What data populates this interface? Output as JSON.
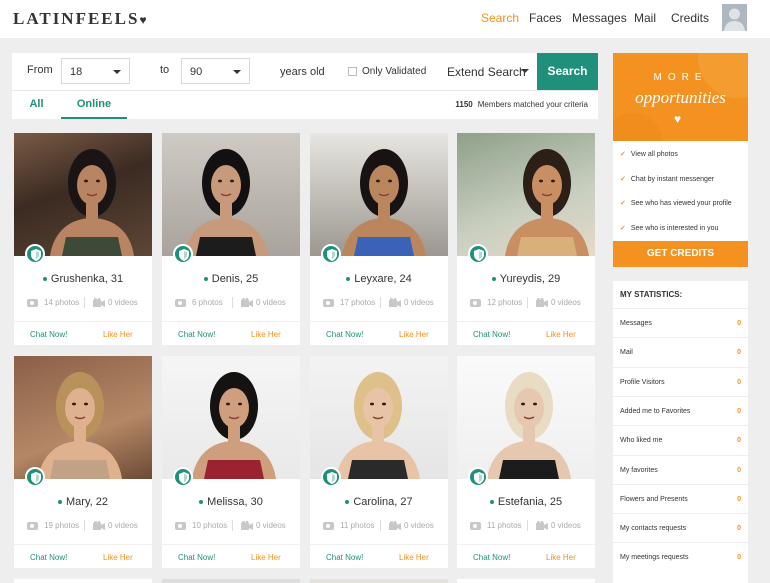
{
  "header": {
    "logo": "LATINFEELS",
    "logo_heart": "♥",
    "nav": [
      "Search",
      "Faces",
      "Messages",
      "Mail",
      "Credits"
    ],
    "active_nav": "Search"
  },
  "search": {
    "from_label": "From",
    "from_value": "18",
    "to_label": "to",
    "to_value": "90",
    "years_label": "years old",
    "only_validated": "Only Validated",
    "extend_search": "Extend Search",
    "search_button": "Search"
  },
  "tabs": [
    "All",
    "Online"
  ],
  "active_tab": "Online",
  "matched": {
    "count": "1150",
    "text": "Members matched your criteria"
  },
  "cards": [
    {
      "name": "Grushenka, 31",
      "photos": "14 photos",
      "videos": "0 videos",
      "chat": "Chat Now!",
      "like": "Like Her"
    },
    {
      "name": "Denis, 25",
      "photos": "6 photos",
      "videos": "0 videos",
      "chat": "Chat Now!",
      "like": "Like Her"
    },
    {
      "name": "Leyxare, 24",
      "photos": "17 photos",
      "videos": "0 videos",
      "chat": "Chat Now!",
      "like": "Like Her"
    },
    {
      "name": "Yureydis, 29",
      "photos": "12 photos",
      "videos": "0 videos",
      "chat": "Chat Now!",
      "like": "Like Her"
    },
    {
      "name": "Mary, 22",
      "photos": "19 photos",
      "videos": "0 videos",
      "chat": "Chat Now!",
      "like": "Like Her"
    },
    {
      "name": "Melissa, 30",
      "photos": "10 photos",
      "videos": "0 videos",
      "chat": "Chat Now!",
      "like": "Like Her"
    },
    {
      "name": "Carolina, 27",
      "photos": "11 photos",
      "videos": "0 videos",
      "chat": "Chat Now!",
      "like": "Like Her"
    },
    {
      "name": "Estefania, 25",
      "photos": "11 photos",
      "videos": "0 videos",
      "chat": "Chat Now!",
      "like": "Like Her"
    }
  ],
  "promo": {
    "more": "MORE",
    "opportunities": "opportunities",
    "heart": "♥",
    "benefits": [
      "View all photos",
      "Chat by instant messenger",
      "See who has viewed your profile",
      "See who is interested in you"
    ],
    "get_credits": "GET CREDITS"
  },
  "my_statistics": {
    "title": "MY STATISTICS:",
    "rows": [
      {
        "label": "Messages",
        "value": "0"
      },
      {
        "label": "Mail",
        "value": "0"
      },
      {
        "label": "Profile Visitors",
        "value": "0"
      },
      {
        "label": "Added me to Favorites",
        "value": "0"
      },
      {
        "label": "Who liked me",
        "value": "0"
      },
      {
        "label": "My favorites",
        "value": "0"
      },
      {
        "label": "Flowers and Presents",
        "value": "0"
      },
      {
        "label": "My contacts requests",
        "value": "0"
      },
      {
        "label": "My meetings requests",
        "value": "0"
      }
    ]
  },
  "colors": {
    "accent_green": "#1f9079",
    "accent_orange": "#f39220",
    "background": "#eeeeee"
  }
}
